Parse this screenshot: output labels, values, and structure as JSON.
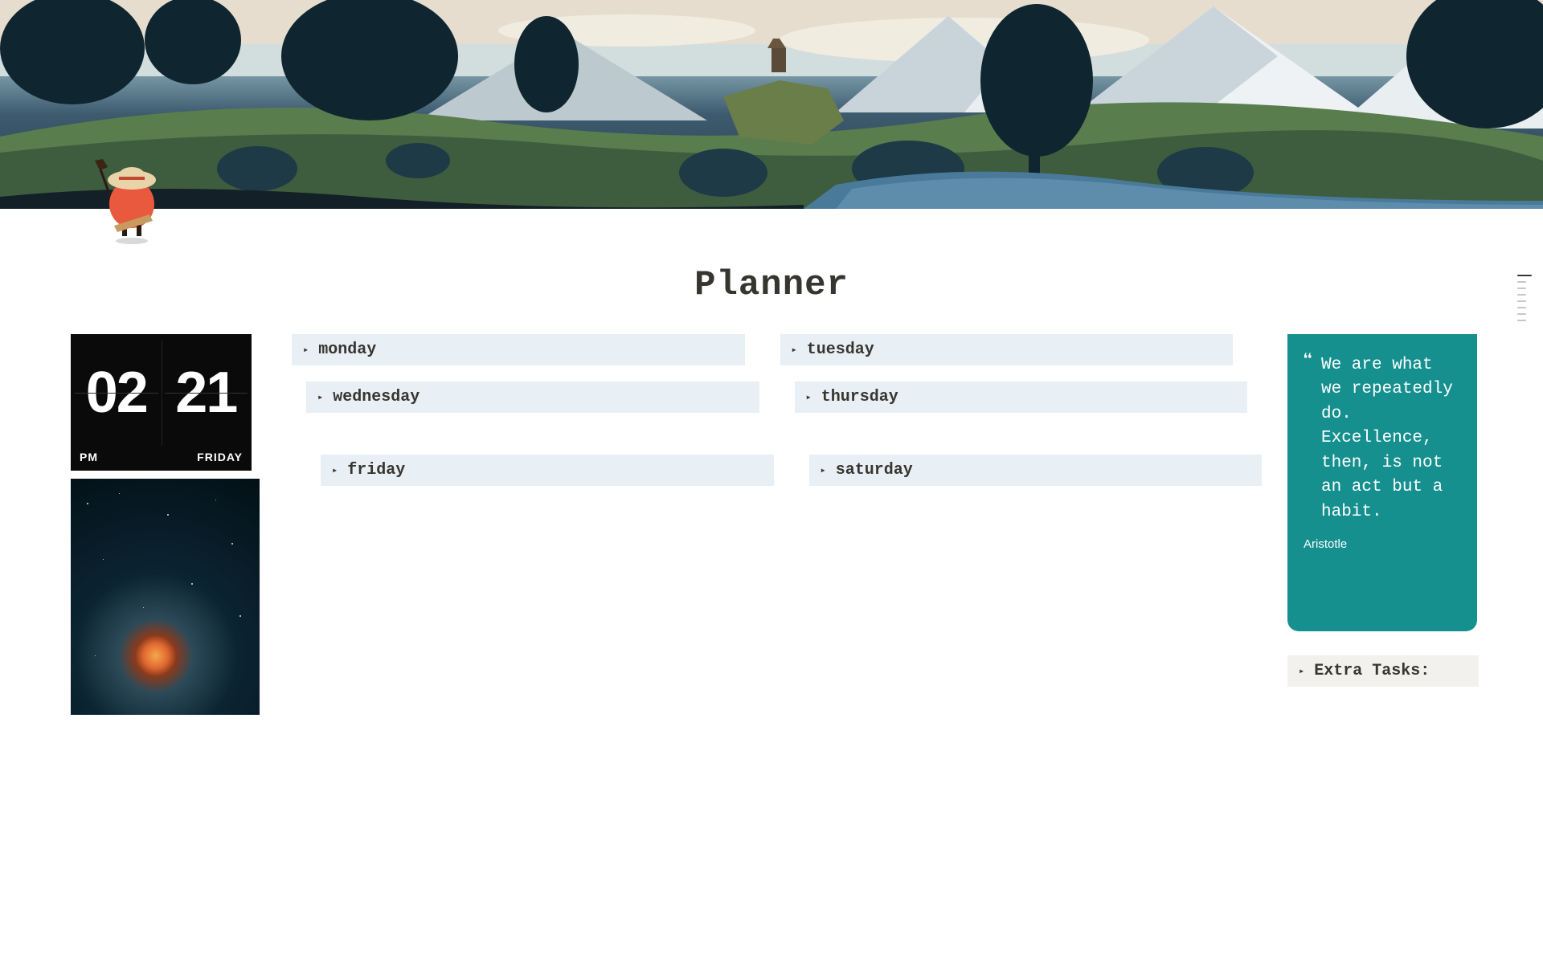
{
  "title": "Planner",
  "clock": {
    "hours": "02",
    "minutes": "21",
    "meridiem": "PM",
    "day": "FRIDAY"
  },
  "days": {
    "monday": {
      "label": "monday"
    },
    "tuesday": {
      "label": "tuesday"
    },
    "wednesday": {
      "label": "wednesday"
    },
    "thursday": {
      "label": "thursday"
    },
    "friday": {
      "label": "friday"
    },
    "saturday": {
      "label": "saturday"
    }
  },
  "quote": {
    "text": "We are what we repeatedly do. Excellence, then, is not an act but a habit.",
    "author": "Aristotle"
  },
  "extra": {
    "label": "Extra Tasks:"
  },
  "icons": {
    "disclosure": "▸",
    "quote_mark": "❝"
  }
}
